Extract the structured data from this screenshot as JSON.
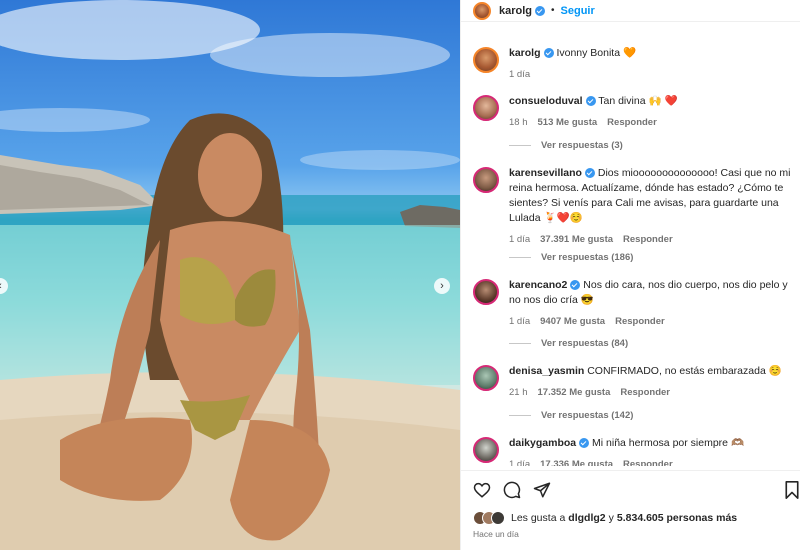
{
  "post": {
    "author": "karolg",
    "follow_label": "Seguir",
    "dot": "•"
  },
  "caption": {
    "user": "karolg",
    "text": "Ivonny Bonita",
    "emoji": "🧡",
    "time": "1 día"
  },
  "comments": [
    {
      "user": "consueloduval",
      "text": "Tan divina",
      "emoji": "🙌 ❤️",
      "time": "18 h",
      "likes": "513 Me gusta",
      "reply": "Responder",
      "view_replies": "Ver respuestas (3)"
    },
    {
      "user": "karensevillano",
      "text": "Dios mioooooooooooooo! Casi que no mi reina hermosa. Actualízame, dónde has estado? ¿Cómo te sientes? Si venís para Cali me avisas, para guardarte una Lulada",
      "emoji": "🍹❤️☺️",
      "time": "1 día",
      "likes": "37.391 Me gusta",
      "reply": "Responder",
      "view_replies": "Ver respuestas (186)"
    },
    {
      "user": "karencano2",
      "text": "Nos dio cara, nos dio cuerpo, nos dio pelo y no nos dio cría",
      "emoji": "😎",
      "time": "1 día",
      "likes": "9407 Me gusta",
      "reply": "Responder",
      "view_replies": "Ver respuestas (84)"
    },
    {
      "user": "denisa_yasmin",
      "text": "CONFIRMADO, no estás embarazada",
      "emoji": "☺️",
      "time": "21 h",
      "likes": "17.352 Me gusta",
      "reply": "Responder",
      "view_replies": "Ver respuestas (142)"
    },
    {
      "user": "daikygamboa",
      "text": "Mi niña hermosa por siempre",
      "emoji": "🫶🏽",
      "time": "1 día",
      "likes": "17.336 Me gusta",
      "reply": "Responder"
    }
  ],
  "likes_bar": {
    "prefix": "Les gusta a",
    "user": "dlgdlg2",
    "middle": "y",
    "count": "5.834.605 personas más"
  },
  "post_time": "Hace un día",
  "colors": {
    "verified": "#3897f0",
    "follow": "#0095f6",
    "text": "#262626",
    "muted": "#737373"
  },
  "icons": [
    "heart-icon",
    "comment-icon",
    "share-icon",
    "bookmark-icon",
    "chevron-left-icon",
    "chevron-right-icon"
  ]
}
